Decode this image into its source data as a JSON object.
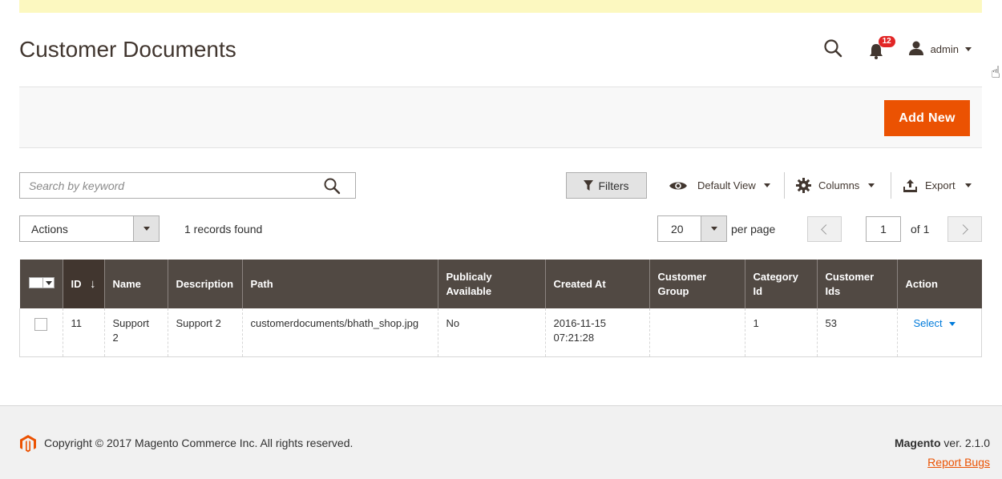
{
  "header": {
    "title": "Customer Documents",
    "notifications_count": "12",
    "user_label": "admin"
  },
  "action_bar": {
    "add_new_label": "Add New"
  },
  "toolbar": {
    "search_placeholder": "Search by keyword",
    "filters_label": "Filters",
    "default_view_label": "Default View",
    "columns_label": "Columns",
    "export_label": "Export"
  },
  "listing": {
    "actions_label": "Actions",
    "records_found": "1 records found",
    "per_page_value": "20",
    "per_page_label": "per page",
    "current_page": "1",
    "of_pages": "of 1"
  },
  "table": {
    "columns": {
      "id": "ID",
      "sort_indicator": "↓",
      "name": "Name",
      "description": "Description",
      "path": "Path",
      "public_1": "Publicaly",
      "public_2": "Available",
      "created_at": "Created At",
      "group_1": "Customer",
      "group_2": "Group",
      "category_1": "Category",
      "category_2": "Id",
      "ids_1": "Customer",
      "ids_2": "Ids",
      "action": "Action"
    },
    "rows": [
      {
        "id": "11",
        "name_1": "Support",
        "name_2": "2",
        "description": "Support 2",
        "path": "customerdocuments/bhath_shop.jpg",
        "public": "No",
        "created_1": "2016-11-15",
        "created_2": "07:21:28",
        "group": "",
        "category": "1",
        "customer_ids": "53",
        "action": "Select"
      }
    ]
  },
  "footer": {
    "copyright": "Copyright © 2017 Magento Commerce Inc. All rights reserved.",
    "brand": "Magento",
    "version": " ver. 2.1.0",
    "report_bugs": "Report Bugs"
  },
  "colors": {
    "accent": "#eb5202",
    "table_header": "#514943",
    "notice_bar": "#fcf8c0",
    "link": "#007bdb"
  },
  "icons": [
    "search-icon",
    "bell-icon",
    "user-icon",
    "filter-icon",
    "eye-icon",
    "gear-icon",
    "export-icon",
    "magento-logo-icon"
  ]
}
